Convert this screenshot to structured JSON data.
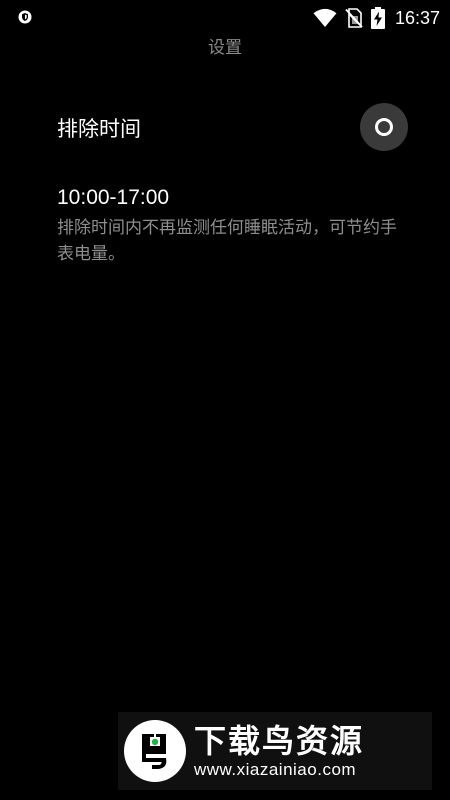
{
  "status_bar": {
    "time": "16:37",
    "icons": [
      "shield-icon",
      "wifi-icon",
      "no-sim-icon",
      "battery-charging-icon"
    ]
  },
  "header": {
    "title": "设置"
  },
  "setting": {
    "label": "排除时间",
    "toggle_state": "on",
    "time_range": "10:00-17:00",
    "description": "排除时间内不再监测任何睡眠活动，可节约手表电量。"
  },
  "watermark": {
    "brand": "下载鸟资源",
    "url": "www.xiazainiao.com"
  },
  "colors": {
    "background": "#000000",
    "title_gray": "#8a8a8a",
    "description_gray": "#8e8e8e",
    "toggle_bg": "#3a3a3a",
    "logo_green": "#22b14c"
  }
}
